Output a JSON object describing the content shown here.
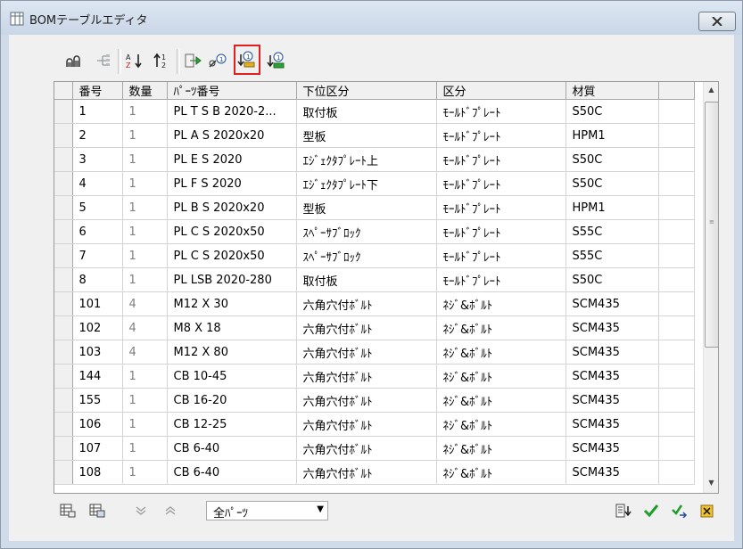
{
  "window": {
    "title": "BOMテーブルエディタ"
  },
  "grid": {
    "columns": [
      "番号",
      "数量",
      "ﾊﾟｰﾂ番号",
      "下位区分",
      "区分",
      "材質",
      ""
    ],
    "rows": [
      [
        "1",
        "1",
        "PL T S B 2020-2...",
        "取付板",
        "ﾓｰﾙﾄﾞﾌﾟﾚｰﾄ",
        "S50C"
      ],
      [
        "2",
        "1",
        "PL A S 2020x20",
        "型板",
        "ﾓｰﾙﾄﾞﾌﾟﾚｰﾄ",
        "HPM1"
      ],
      [
        "3",
        "1",
        "PL E S 2020",
        "ｴｼﾞｪｸﾀﾌﾟﾚｰﾄ上",
        "ﾓｰﾙﾄﾞﾌﾟﾚｰﾄ",
        "S50C"
      ],
      [
        "4",
        "1",
        "PL F S 2020",
        "ｴｼﾞｪｸﾀﾌﾟﾚｰﾄ下",
        "ﾓｰﾙﾄﾞﾌﾟﾚｰﾄ",
        "S50C"
      ],
      [
        "5",
        "1",
        "PL B S 2020x20",
        "型板",
        "ﾓｰﾙﾄﾞﾌﾟﾚｰﾄ",
        "HPM1"
      ],
      [
        "6",
        "1",
        "PL C S 2020x50",
        "ｽﾍﾟｰｻﾌﾞﾛｯｸ",
        "ﾓｰﾙﾄﾞﾌﾟﾚｰﾄ",
        "S55C"
      ],
      [
        "7",
        "1",
        "PL C S 2020x50",
        "ｽﾍﾟｰｻﾌﾞﾛｯｸ",
        "ﾓｰﾙﾄﾞﾌﾟﾚｰﾄ",
        "S55C"
      ],
      [
        "8",
        "1",
        "PL LSB 2020-280",
        "取付板",
        "ﾓｰﾙﾄﾞﾌﾟﾚｰﾄ",
        "S50C"
      ],
      [
        "101",
        "4",
        "M12 X 30",
        "六角穴付ﾎﾞﾙﾄ",
        "ﾈｼﾞ&ﾎﾞﾙﾄ",
        "SCM435"
      ],
      [
        "102",
        "4",
        "M8 X 18",
        "六角穴付ﾎﾞﾙﾄ",
        "ﾈｼﾞ&ﾎﾞﾙﾄ",
        "SCM435"
      ],
      [
        "103",
        "4",
        "M12 X 80",
        "六角穴付ﾎﾞﾙﾄ",
        "ﾈｼﾞ&ﾎﾞﾙﾄ",
        "SCM435"
      ],
      [
        "144",
        "1",
        "CB 10-45",
        "六角穴付ﾎﾞﾙﾄ",
        "ﾈｼﾞ&ﾎﾞﾙﾄ",
        "SCM435"
      ],
      [
        "155",
        "1",
        "CB 16-20",
        "六角穴付ﾎﾞﾙﾄ",
        "ﾈｼﾞ&ﾎﾞﾙﾄ",
        "SCM435"
      ],
      [
        "106",
        "1",
        "CB 12-25",
        "六角穴付ﾎﾞﾙﾄ",
        "ﾈｼﾞ&ﾎﾞﾙﾄ",
        "SCM435"
      ],
      [
        "107",
        "1",
        "CB 6-40",
        "六角穴付ﾎﾞﾙﾄ",
        "ﾈｼﾞ&ﾎﾞﾙﾄ",
        "SCM435"
      ],
      [
        "108",
        "1",
        "CB 6-40",
        "六角穴付ﾎﾞﾙﾄ",
        "ﾈｼﾞ&ﾎﾞﾙﾄ",
        "SCM435"
      ]
    ]
  },
  "toolbar": {
    "buttons": [
      {
        "icon": "columns-chart-icon"
      },
      {
        "icon": "tree-structure-icon"
      },
      {
        "icon": "sort-az-icon"
      },
      {
        "icon": "sort-numeric-icon"
      },
      {
        "icon": "export-arrow-icon"
      },
      {
        "icon": "renumber-link-icon"
      },
      {
        "icon": "balloon-down-icon",
        "highlighted": true
      },
      {
        "icon": "balloon-sort-icon"
      }
    ]
  },
  "filter": {
    "selected": "全ﾊﾟｰﾂ"
  },
  "colors": {
    "highlight": "#e02020",
    "accent_green": "#1e9e2a"
  }
}
